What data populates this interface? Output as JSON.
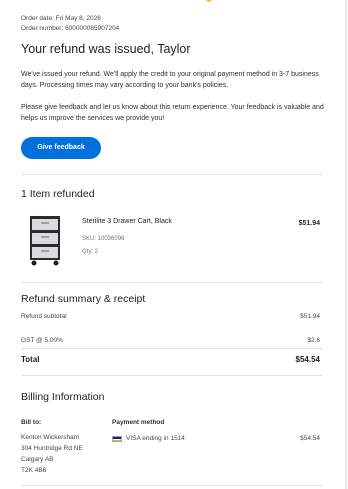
{
  "order": {
    "date": "Order date: Fri May 8, 2026",
    "number": "Order number: 600000085907204"
  },
  "heading": "Your refund was issued, Taylor",
  "intro_text": "We've issued your refund. We'll apply the credit to your original payment method in 3-7 business days. Processing times may vary according to your bank's policies.",
  "feedback_text": "Please give feedback and let us know about this return experience. Your feedback is valuable and helps us improve the services we provide you!",
  "feedback_button": "Give feedback",
  "items_section": {
    "title": "1 Item refunded",
    "items": [
      {
        "name": "Sterilite 3 Drawer Cart, Black",
        "sku": "SKU: 10036096",
        "qty": "Qty: 2",
        "price": "$51.94",
        "icon": "drawer-cart-icon"
      }
    ]
  },
  "summary": {
    "title": "Refund summary & receipt",
    "subtotal_label": "Refund subtotal",
    "subtotal_value": "$51.94",
    "tax_label": "GST @ 5.00%",
    "tax_value": "$2.6",
    "total_label": "Total",
    "total_value": "$54.54"
  },
  "billing": {
    "title": "Billing Information",
    "bill_to_label": "Bill to:",
    "address_lines": [
      "Kenton Wickersham",
      "304 Huntridge Rd NE",
      "Calgary AB",
      "T2K 4B6"
    ],
    "payment_method_label": "Payment method",
    "payment_text": "VISA ending in 1514",
    "payment_icon": "visa-card-icon",
    "payment_amount": "$54.54"
  },
  "colors": {
    "accent": "#0071dc",
    "spark": "#ffc220",
    "divider": "#e3e4e5"
  }
}
